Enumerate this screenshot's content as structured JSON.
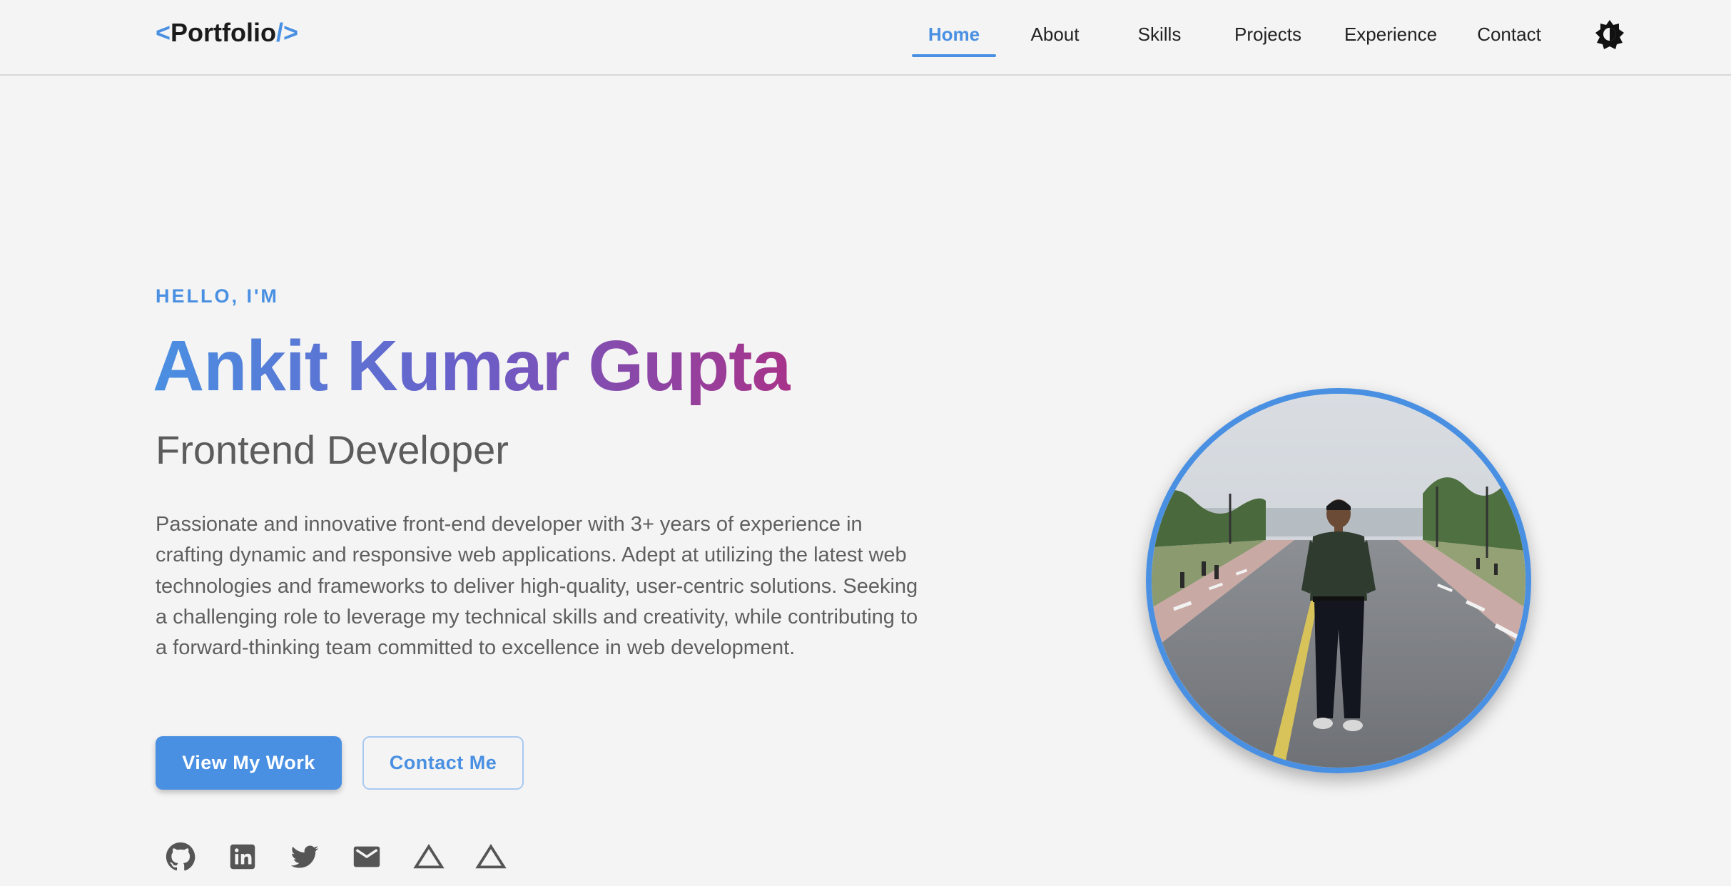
{
  "header": {
    "logo": {
      "open": "<",
      "text": "Portfolio",
      "close": "/>"
    },
    "nav": [
      {
        "label": "Home",
        "active": true
      },
      {
        "label": "About"
      },
      {
        "label": "Skills"
      },
      {
        "label": "Projects"
      },
      {
        "label": "Experience"
      },
      {
        "label": "Contact"
      }
    ],
    "theme_toggle_icon": "brightness-icon"
  },
  "hero": {
    "greeting": "HELLO, I'M",
    "name": "Ankit Kumar Gupta",
    "role": "Frontend Developer",
    "description": "Passionate and innovative front-end developer with 3+ years of experience in crafting dynamic and responsive web applications. Adept at utilizing the latest web technologies and frameworks to deliver high-quality, user-centric solutions. Seeking a challenging role to leverage my technical skills and creativity, while contributing to a forward-thinking team committed to excellence in web development.",
    "primary_button": "View My Work",
    "secondary_button": "Contact Me",
    "social_icons": [
      "github-icon",
      "linkedin-icon",
      "twitter-icon",
      "email-icon",
      "triangle-icon",
      "triangle-icon"
    ]
  },
  "colors": {
    "accent": "#4a90e2",
    "name_gradient_start": "#4a90e2",
    "name_gradient_end": "#a8338a",
    "background": "#f4f4f4"
  }
}
